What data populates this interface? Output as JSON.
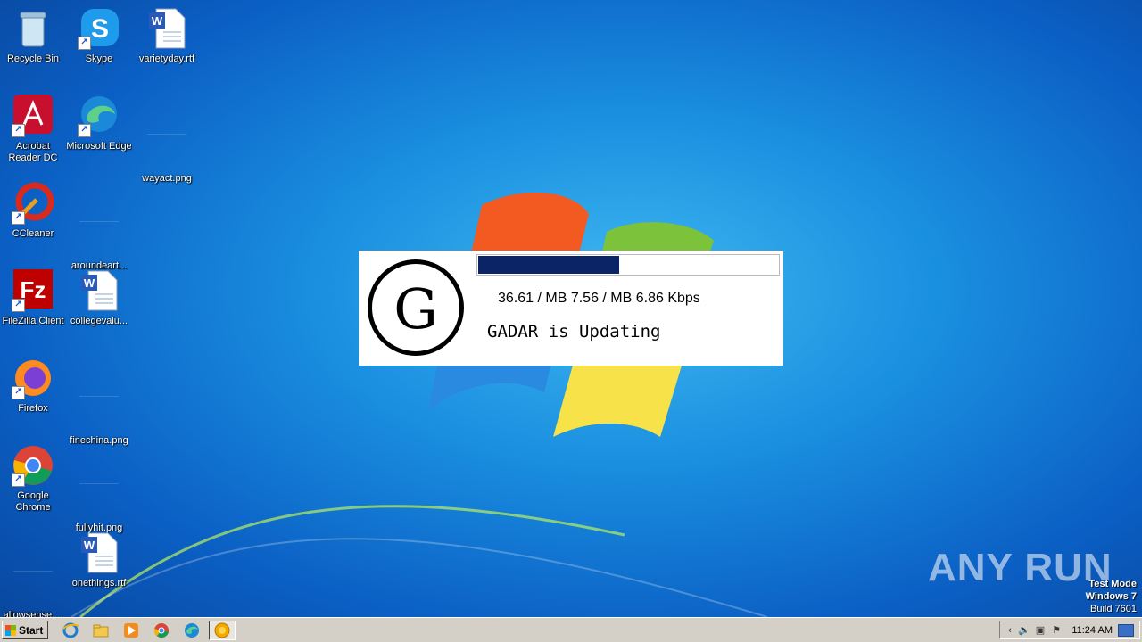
{
  "desktop": {
    "icons": [
      {
        "label": "Recycle Bin"
      },
      {
        "label": "Skype"
      },
      {
        "label": "varietyday.rtf"
      },
      {
        "label": "Acrobat Reader DC"
      },
      {
        "label": "Microsoft Edge"
      },
      {
        "label": "wayact.png"
      },
      {
        "label": "CCleaner"
      },
      {
        "label": "aroundeart..."
      },
      {
        "label": "FileZilla Client"
      },
      {
        "label": "collegevalu..."
      },
      {
        "label": "Firefox"
      },
      {
        "label": "finechina.png"
      },
      {
        "label": "Google Chrome"
      },
      {
        "label": "fullyhit.png"
      },
      {
        "label": "allowsense...."
      },
      {
        "label": "onethings.rtf"
      }
    ]
  },
  "popup": {
    "logo_letter": "G",
    "stats": "36.61 / MB 7.56 / MB 6.86 Kbps",
    "status": "GADAR is Updating",
    "progress_fraction": 0.47,
    "progress_color": "#0b2466"
  },
  "watermark": {
    "brand": "ANY RUN",
    "test_mode": "Test Mode",
    "os": "Windows 7",
    "build": "Build 7601"
  },
  "taskbar": {
    "start_label": "Start",
    "clock": "11:24 AM",
    "pinned": [
      "ie-icon",
      "explorer-icon",
      "media-player-icon",
      "chrome-icon",
      "edge-icon",
      "gadar-app-icon"
    ]
  }
}
